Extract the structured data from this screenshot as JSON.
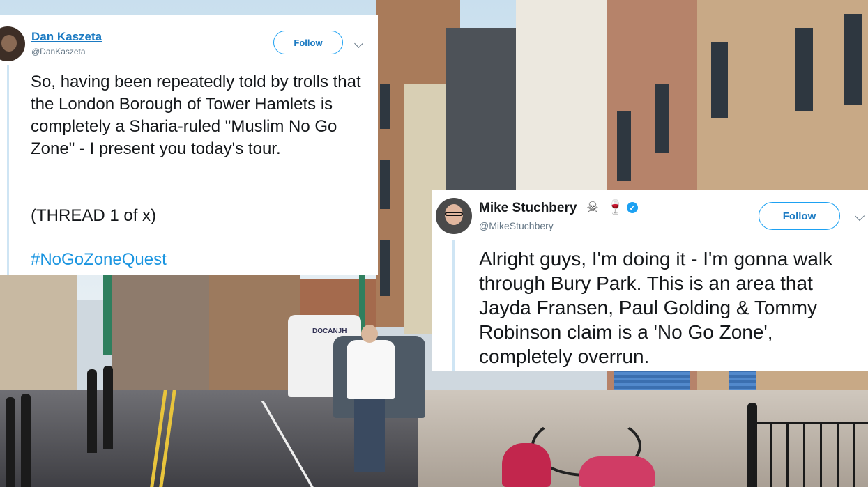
{
  "tweet1": {
    "display_name": "Dan Kaszeta",
    "handle": "@DanKaszeta",
    "follow_label": "Follow",
    "body": "So, having been repeatedly told by trolls that the London Borough of Tower Hamlets is completely a Sharia-ruled \"Muslim No Go Zone\" - I present you today's tour.",
    "thread_note": "(THREAD 1 of x)",
    "hashtag": "#NoGoZoneQuest"
  },
  "tweet2": {
    "display_name": "Mike Stuchbery",
    "name_emoji_1": "skull",
    "name_emoji_2": "wine-glass",
    "handle": "@MikeStuchbery_",
    "follow_label": "Follow",
    "body": "Alright guys, I'm doing it - I'm gonna walk through Bury Park. This is an area that Jayda Fransen, Paul Golding & Tommy Robinson claim is a 'No Go Zone', completely overrun."
  },
  "background": {
    "van_lettering": "DOCANJH"
  },
  "colors": {
    "link_blue": "#1b95e0",
    "follow_border": "#1da1f2",
    "verified_blue": "#1da1f2"
  }
}
